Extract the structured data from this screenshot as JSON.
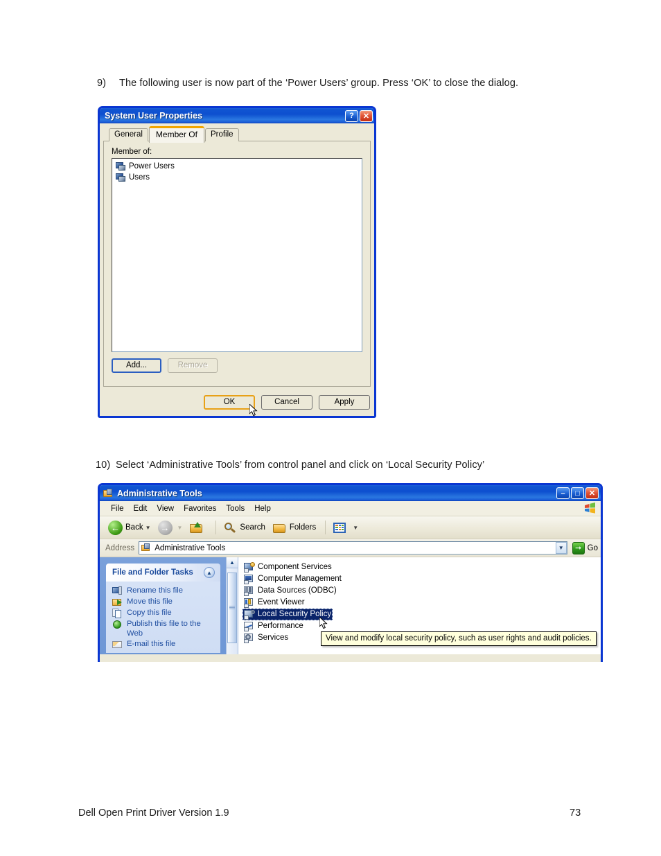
{
  "document": {
    "step9": {
      "number": "9)",
      "text": "The following user is now part of the ‘Power Users’ group. Press ‘OK’ to close the dialog."
    },
    "step10": {
      "number": "10)",
      "text": "Select ‘Administrative Tools’ from control panel and click on ‘Local Security Policy’"
    },
    "footer": {
      "left": "Dell Open Print Driver Version 1.9",
      "page": "73"
    }
  },
  "properties_dialog": {
    "title": "System User Properties",
    "titlebar_buttons": [
      {
        "name": "help-button",
        "glyph": "?"
      },
      {
        "name": "close-button",
        "glyph": "✕"
      }
    ],
    "tabs": [
      {
        "label": "General",
        "active": false
      },
      {
        "label": "Member Of",
        "active": true
      },
      {
        "label": "Profile",
        "active": false
      }
    ],
    "member_of_label": "Member of:",
    "members": [
      {
        "name": "Power Users",
        "icon": "group-icon"
      },
      {
        "name": "Users",
        "icon": "group-icon"
      }
    ],
    "list_buttons": [
      {
        "label": "Add...",
        "state": "focused"
      },
      {
        "label": "Remove",
        "state": "disabled"
      }
    ],
    "footer_buttons": [
      {
        "label": "OK",
        "state": "default"
      },
      {
        "label": "Cancel",
        "state": "normal"
      },
      {
        "label": "Apply",
        "state": "normal"
      }
    ],
    "colors": {
      "titlebar_blue": "#0d4fcf",
      "window_border": "#0a36d2",
      "face": "#ece9d8",
      "active_tab_accent": "#f0a500",
      "default_button_accent": "#e8a117"
    }
  },
  "admin_tools_window": {
    "title": "Administrative Tools",
    "titlebar_buttons": [
      {
        "name": "minimize-button",
        "glyph": "–"
      },
      {
        "name": "maximize-button",
        "glyph": "□"
      },
      {
        "name": "close-button",
        "glyph": "✕"
      }
    ],
    "menu": [
      "File",
      "Edit",
      "View",
      "Favorites",
      "Tools",
      "Help"
    ],
    "toolbar": {
      "back": "Back",
      "forward": "",
      "up": "",
      "search": "Search",
      "folders": "Folders",
      "views": ""
    },
    "address": {
      "label": "Address",
      "value": "Administrative Tools",
      "go_label": "Go"
    },
    "task_pane": {
      "title": "File and Folder Tasks",
      "items": [
        {
          "label": "Rename this file",
          "icon": "rename-icon"
        },
        {
          "label": "Move this file",
          "icon": "move-icon"
        },
        {
          "label": "Copy this file",
          "icon": "copy-icon"
        },
        {
          "label": "Publish this file to the Web",
          "icon": "publish-icon"
        },
        {
          "label": "E-mail this file",
          "icon": "email-icon"
        }
      ]
    },
    "files": [
      {
        "label": "Component Services",
        "icon": "component-services-icon",
        "selected": false
      },
      {
        "label": "Computer Management",
        "icon": "computer-management-icon",
        "selected": false
      },
      {
        "label": "Data Sources (ODBC)",
        "icon": "data-sources-icon",
        "selected": false
      },
      {
        "label": "Event Viewer",
        "icon": "event-viewer-icon",
        "selected": false
      },
      {
        "label": "Local Security Policy",
        "icon": "local-security-policy-icon",
        "selected": true
      },
      {
        "label": "Performance",
        "icon": "performance-icon",
        "selected": false
      },
      {
        "label": "Services",
        "icon": "services-icon",
        "selected": false
      }
    ],
    "tooltip": "View and modify local security policy, such as user rights and audit policies.",
    "colors": {
      "task_pane_blue": "#6e97d6",
      "selection_blue": "#0a246a",
      "tooltip_bg": "#ffffdc"
    }
  }
}
